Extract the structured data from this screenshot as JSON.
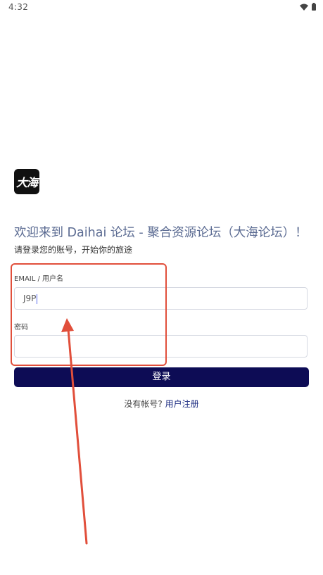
{
  "status_bar": {
    "time": "4:32",
    "icons": [
      "wifi-icon",
      "battery-icon"
    ]
  },
  "logo": {
    "text": "大海"
  },
  "header": {
    "title": "欢迎来到 Daihai 论坛 - 聚合资源论坛（大海论坛）！",
    "subtitle": "请登录您的账号，开始你的旅途"
  },
  "form": {
    "email_label": "EMAIL / 用户名",
    "email_value": "J9P",
    "password_label": "密码",
    "password_value": "",
    "login_label": "登录"
  },
  "footer": {
    "no_account": "没有帐号?",
    "register_link": "用户注册"
  },
  "colors": {
    "accent": "#0d0c55",
    "annotation": "#e14f3b",
    "title": "#5b6b92"
  }
}
